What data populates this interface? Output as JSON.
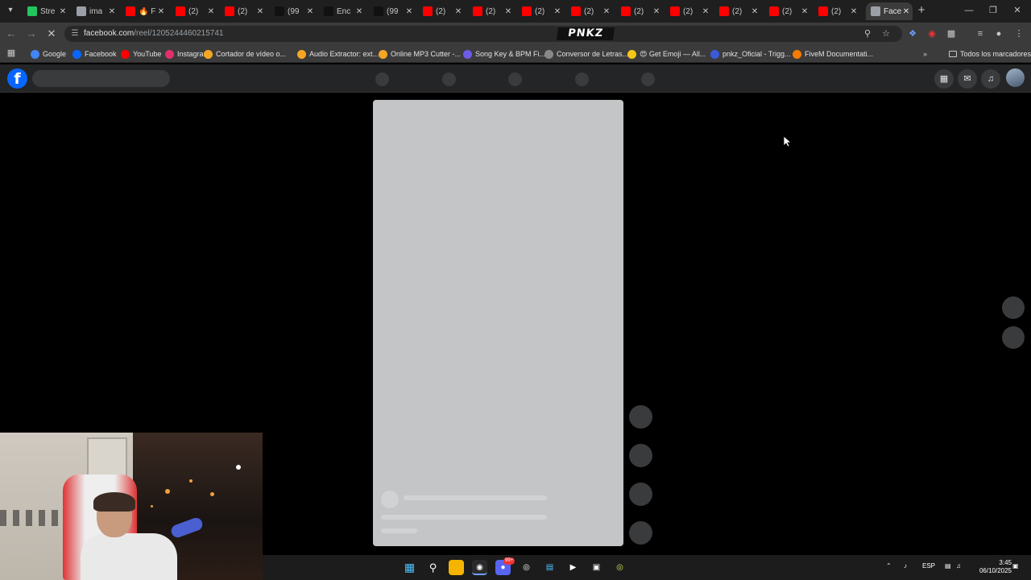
{
  "browser": {
    "tabs": [
      {
        "label": "Stre",
        "fav": "#22c55e"
      },
      {
        "label": "ima",
        "fav": "#9aa0a6"
      },
      {
        "label": "🔥 F",
        "fav": "#ff0000"
      },
      {
        "label": "(2)",
        "fav": "#ff0000"
      },
      {
        "label": "(2)",
        "fav": "#ff0000"
      },
      {
        "label": "(99",
        "fav": "#111111"
      },
      {
        "label": "Enc",
        "fav": "#111111"
      },
      {
        "label": "(99",
        "fav": "#111111"
      },
      {
        "label": "(2)",
        "fav": "#ff0000"
      },
      {
        "label": "(2)",
        "fav": "#ff0000"
      },
      {
        "label": "(2)",
        "fav": "#ff0000"
      },
      {
        "label": "(2)",
        "fav": "#ff0000"
      },
      {
        "label": "(2)",
        "fav": "#ff0000"
      },
      {
        "label": "(2)",
        "fav": "#ff0000"
      },
      {
        "label": "(2)",
        "fav": "#ff0000"
      },
      {
        "label": "(2)",
        "fav": "#ff0000"
      },
      {
        "label": "(2)",
        "fav": "#ff0000"
      },
      {
        "label": "Face",
        "fav": "#9aa0a6",
        "active": true
      }
    ],
    "url_host": "facebook.com",
    "url_path": "/reel/1205244460215741",
    "overlay_logo": "PNKZ",
    "bookmarks": [
      {
        "label": "Google",
        "color": "#4285f4"
      },
      {
        "label": "Facebook",
        "color": "#0866ff"
      },
      {
        "label": "YouTube",
        "color": "#ff0000"
      },
      {
        "label": "Instagram",
        "color": "#e1306c"
      },
      {
        "label": "Cortador de vídeo o...",
        "color": "#f5a623"
      },
      {
        "label": "Audio Extractor: ext...",
        "color": "#f5a623"
      },
      {
        "label": "Online MP3 Cutter -...",
        "color": "#f5a623"
      },
      {
        "label": "Song Key & BPM Fi...",
        "color": "#6c5ce7"
      },
      {
        "label": "Conversor de Letras...",
        "color": "#888888"
      },
      {
        "label": "😍 Get Emoji — All...",
        "color": "#f5c518"
      },
      {
        "label": "pnkz_Oficial - Trigg...",
        "color": "#3b5bdb"
      },
      {
        "label": "FiveM Documentati...",
        "color": "#f57c00"
      }
    ],
    "all_bookmarks": "Todos los marcadores",
    "colors": {
      "tabstrip": "#1f1f1f",
      "toolbar": "#3b3b3b"
    }
  },
  "facebook": {
    "accent": "#0866ff",
    "logo_letter": "f"
  },
  "taskbar": {
    "language": "ESP",
    "time": "3:45",
    "date": "06/10/2025",
    "chat_badge": "99+"
  }
}
